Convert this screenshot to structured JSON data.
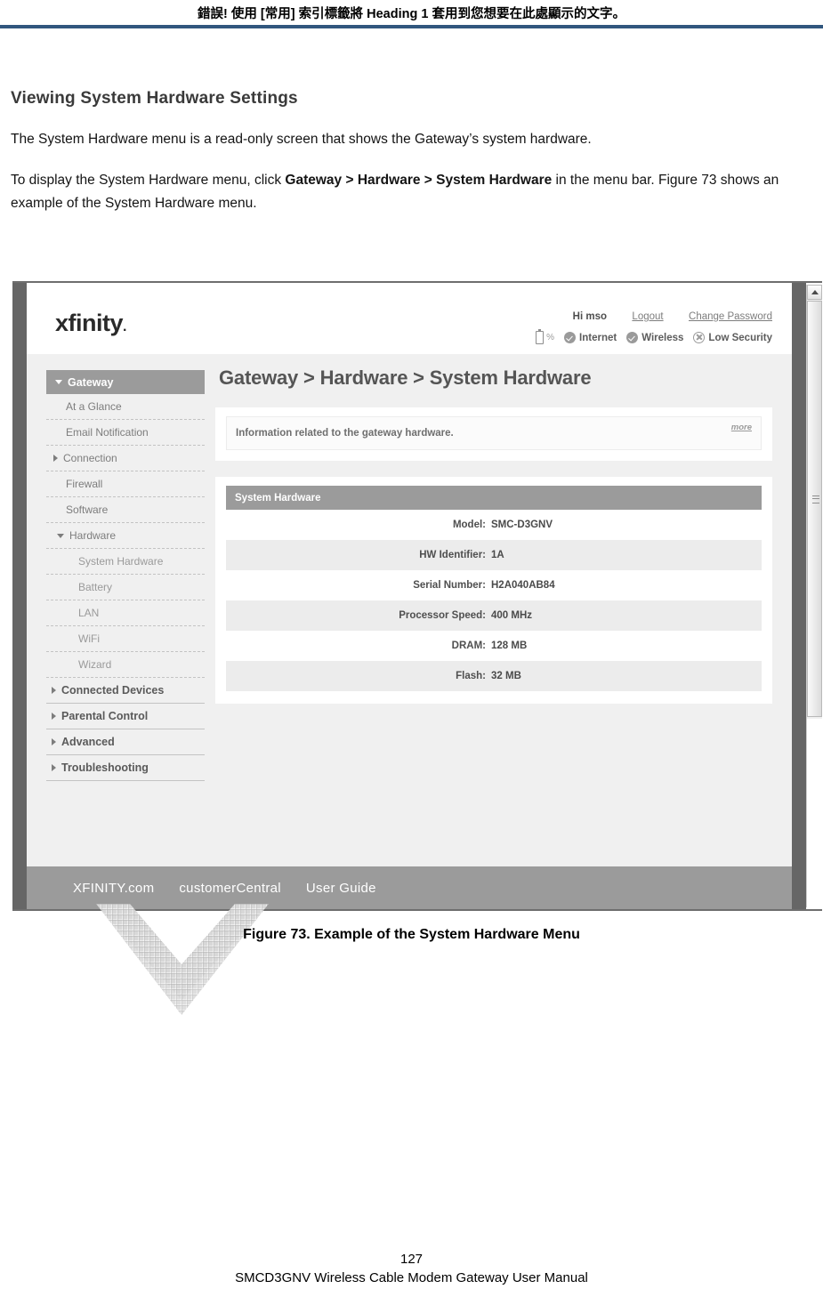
{
  "doc": {
    "header_note": "錯誤! 使用 [常用] 索引標籤將 Heading 1 套用到您想要在此處顯示的文字。",
    "section_title": "Viewing System Hardware Settings",
    "paragraph_1": "The System Hardware menu is a read-only screen that shows the Gateway’s system hardware.",
    "paragraph_2_before": "To display the System Hardware menu, click ",
    "paragraph_2_bold": "Gateway > Hardware > System Hardware",
    "paragraph_2_after": " in the menu bar. Figure 73 shows an example of the System Hardware menu.",
    "figure_caption": "Figure 73. Example of the System Hardware Menu",
    "page_number": "127",
    "footer_title": "SMCD3GNV Wireless Cable Modem Gateway User Manual",
    "rule_color": "#31577e"
  },
  "screenshot": {
    "brand": {
      "logo_text": "xfinity",
      "logo_dot": "."
    },
    "account": {
      "greeting": "Hi mso",
      "logout_label": "Logout",
      "change_password_label": "Change Password"
    },
    "status": {
      "battery_icon": "battery-icon",
      "battery_percent_label": "%",
      "items": [
        {
          "icon": "check-circle-icon",
          "label": "Internet"
        },
        {
          "icon": "check-circle-icon",
          "label": "Wireless"
        },
        {
          "icon": "warning-circle-icon",
          "label": "Low Security"
        }
      ]
    },
    "sidebar": {
      "active_group": "Gateway",
      "items": [
        {
          "label": "Gateway",
          "type": "top",
          "caret": "down"
        },
        {
          "label": "At a Glance",
          "type": "item",
          "caret": "none"
        },
        {
          "label": "Email Notification",
          "type": "item",
          "caret": "none"
        },
        {
          "label": "Connection",
          "type": "item",
          "caret": "right"
        },
        {
          "label": "Firewall",
          "type": "item",
          "caret": "none"
        },
        {
          "label": "Software",
          "type": "item",
          "caret": "none"
        },
        {
          "label": "Hardware",
          "type": "item",
          "caret": "down"
        },
        {
          "label": "System Hardware",
          "type": "sub",
          "caret": "none"
        },
        {
          "label": "Battery",
          "type": "sub",
          "caret": "none"
        },
        {
          "label": "LAN",
          "type": "sub",
          "caret": "none"
        },
        {
          "label": "WiFi",
          "type": "sub",
          "caret": "none"
        },
        {
          "label": "Wizard",
          "type": "sub",
          "caret": "none"
        },
        {
          "label": "Connected Devices",
          "type": "group",
          "caret": "right"
        },
        {
          "label": "Parental Control",
          "type": "group",
          "caret": "right"
        },
        {
          "label": "Advanced",
          "type": "group",
          "caret": "right"
        },
        {
          "label": "Troubleshooting",
          "type": "group",
          "caret": "right"
        }
      ]
    },
    "main": {
      "page_title": "Gateway > Hardware > System Hardware",
      "info_text": "Information related to the gateway hardware.",
      "more_label": "more",
      "panel_title": "System Hardware",
      "rows": [
        {
          "label": "Model:",
          "value": "SMC-D3GNV"
        },
        {
          "label": "HW Identifier:",
          "value": "1A"
        },
        {
          "label": "Serial Number:",
          "value": "H2A040AB84"
        },
        {
          "label": "Processor Speed:",
          "value": "400 MHz"
        },
        {
          "label": "DRAM:",
          "value": "128 MB"
        },
        {
          "label": "Flash:",
          "value": "32 MB"
        }
      ]
    },
    "footer_links": [
      {
        "label": "XFINITY.com"
      },
      {
        "label": "customerCentral"
      },
      {
        "label": "User Guide"
      }
    ],
    "colors": {
      "header_gray": "#9b9b9b",
      "page_bg": "#f0f0f0",
      "alt_row": "#ececec",
      "frame_gray": "#666666"
    }
  }
}
